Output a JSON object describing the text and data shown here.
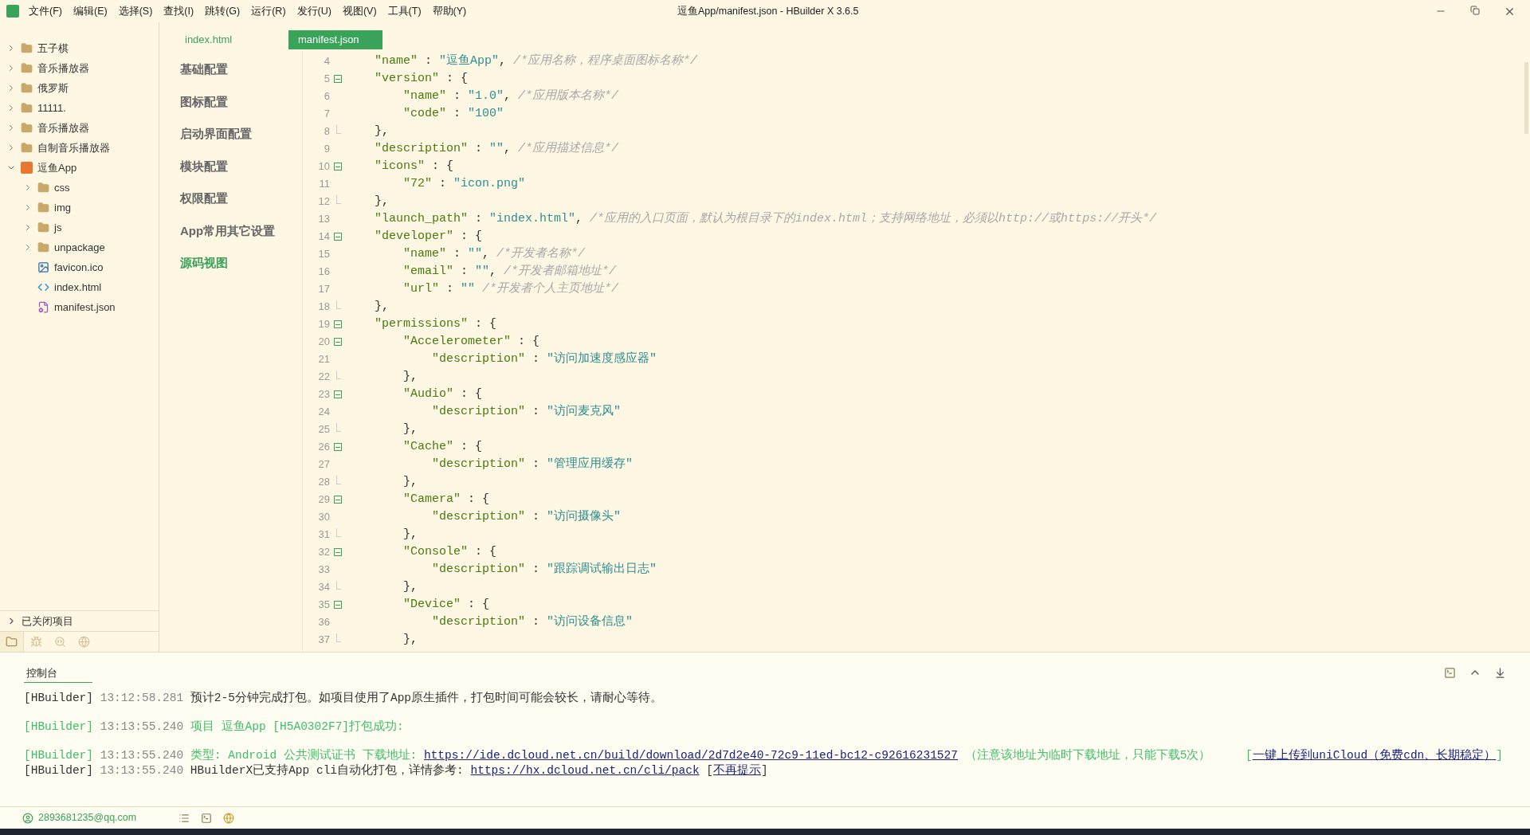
{
  "window": {
    "title": "逗鱼App/manifest.json - HBuilder X 3.6.5"
  },
  "menu": [
    "文件(F)",
    "编辑(E)",
    "选择(S)",
    "查找(I)",
    "跳转(G)",
    "运行(R)",
    "发行(U)",
    "视图(V)",
    "工具(T)",
    "帮助(Y)"
  ],
  "explorer": {
    "items": [
      {
        "name": "五子棋",
        "kind": "folder",
        "expanded": false
      },
      {
        "name": "音乐播放器",
        "kind": "folder",
        "expanded": false
      },
      {
        "name": "俄罗斯",
        "kind": "folder",
        "expanded": false
      },
      {
        "name": "11111.",
        "kind": "folder",
        "expanded": false
      },
      {
        "name": "音乐播放器",
        "kind": "folder",
        "expanded": false
      },
      {
        "name": "自制音乐播放器",
        "kind": "folder",
        "expanded": false
      },
      {
        "name": "逗鱼App",
        "kind": "project",
        "expanded": true,
        "children": [
          {
            "name": "css",
            "kind": "dir",
            "expanded": false
          },
          {
            "name": "img",
            "kind": "dir",
            "expanded": false
          },
          {
            "name": "js",
            "kind": "dir",
            "expanded": false
          },
          {
            "name": "unpackage",
            "kind": "dir",
            "expanded": false
          },
          {
            "name": "favicon.ico",
            "kind": "image"
          },
          {
            "name": "index.html",
            "kind": "html"
          },
          {
            "name": "manifest.json",
            "kind": "json"
          }
        ]
      }
    ],
    "closed_projects": {
      "label": "已关闭项目",
      "expanded": false
    },
    "tabs": [
      {
        "kind": "files",
        "selected": true
      },
      {
        "kind": "debug",
        "selected": false
      },
      {
        "kind": "search",
        "selected": false
      },
      {
        "kind": "cloud",
        "selected": false
      }
    ]
  },
  "editor_tabs": [
    {
      "label": "index.html",
      "selected": false
    },
    {
      "label": "manifest.json",
      "selected": true
    }
  ],
  "config_nav": [
    {
      "label": "基础配置",
      "selected": false
    },
    {
      "label": "图标配置",
      "selected": false
    },
    {
      "label": "启动界面配置",
      "selected": false
    },
    {
      "label": "模块配置",
      "selected": false
    },
    {
      "label": "权限配置",
      "selected": false
    },
    {
      "label": "App常用其它设置",
      "selected": false
    },
    {
      "label": "源码视图",
      "selected": true
    }
  ],
  "code": [
    {
      "no": "4",
      "kind": "plain",
      "parts": [
        {
          "kind": "key",
          "text": "    \"name\""
        },
        {
          "kind": "punct",
          "text": " : "
        },
        {
          "kind": "string",
          "text": "\"逗鱼App\""
        },
        {
          "kind": "punct",
          "text": ", "
        },
        {
          "kind": "comment",
          "text": "/*应用名称，程序桌面图标名称*/"
        }
      ]
    },
    {
      "no": "5",
      "kind": "fold-start",
      "parts": [
        {
          "kind": "key",
          "text": "    \"version\""
        },
        {
          "kind": "punct",
          "text": " : {"
        }
      ]
    },
    {
      "no": "6",
      "kind": "plain",
      "parts": [
        {
          "kind": "key",
          "text": "        \"name\""
        },
        {
          "kind": "punct",
          "text": " : "
        },
        {
          "kind": "string",
          "text": "\"1.0\""
        },
        {
          "kind": "punct",
          "text": ", "
        },
        {
          "kind": "comment",
          "text": "/*应用版本名称*/"
        }
      ]
    },
    {
      "no": "7",
      "kind": "plain",
      "parts": [
        {
          "kind": "key",
          "text": "        \"code\""
        },
        {
          "kind": "punct",
          "text": " : "
        },
        {
          "kind": "string",
          "text": "\"100\""
        }
      ]
    },
    {
      "no": "8",
      "kind": "fold-end",
      "parts": [
        {
          "kind": "punct",
          "text": "    },"
        }
      ]
    },
    {
      "no": "9",
      "kind": "plain",
      "parts": [
        {
          "kind": "key",
          "text": "    \"description\""
        },
        {
          "kind": "punct",
          "text": " : "
        },
        {
          "kind": "string",
          "text": "\"\""
        },
        {
          "kind": "punct",
          "text": ", "
        },
        {
          "kind": "comment",
          "text": "/*应用描述信息*/"
        }
      ]
    },
    {
      "no": "10",
      "kind": "fold-start",
      "parts": [
        {
          "kind": "key",
          "text": "    \"icons\""
        },
        {
          "kind": "punct",
          "text": " : {"
        }
      ]
    },
    {
      "no": "11",
      "kind": "plain",
      "parts": [
        {
          "kind": "key",
          "text": "        \"72\""
        },
        {
          "kind": "punct",
          "text": " : "
        },
        {
          "kind": "string",
          "text": "\"icon.png\""
        }
      ]
    },
    {
      "no": "12",
      "kind": "fold-end",
      "parts": [
        {
          "kind": "punct",
          "text": "    },"
        }
      ]
    },
    {
      "no": "13",
      "kind": "plain",
      "parts": [
        {
          "kind": "key",
          "text": "    \"launch_path\""
        },
        {
          "kind": "punct",
          "text": " : "
        },
        {
          "kind": "string",
          "text": "\"index.html\""
        },
        {
          "kind": "punct",
          "text": ", "
        },
        {
          "kind": "comment",
          "text": "/*应用的入口页面，默认为根目录下的index.html；支持网络地址，必须以http://或https://开头*/"
        }
      ]
    },
    {
      "no": "14",
      "kind": "fold-start",
      "parts": [
        {
          "kind": "key",
          "text": "    \"developer\""
        },
        {
          "kind": "punct",
          "text": " : {"
        }
      ]
    },
    {
      "no": "15",
      "kind": "plain",
      "parts": [
        {
          "kind": "key",
          "text": "        \"name\""
        },
        {
          "kind": "punct",
          "text": " : "
        },
        {
          "kind": "string",
          "text": "\"\""
        },
        {
          "kind": "punct",
          "text": ", "
        },
        {
          "kind": "comment",
          "text": "/*开发者名称*/"
        }
      ]
    },
    {
      "no": "16",
      "kind": "plain",
      "parts": [
        {
          "kind": "key",
          "text": "        \"email\""
        },
        {
          "kind": "punct",
          "text": " : "
        },
        {
          "kind": "string",
          "text": "\"\""
        },
        {
          "kind": "punct",
          "text": ", "
        },
        {
          "kind": "comment",
          "text": "/*开发者邮箱地址*/"
        }
      ]
    },
    {
      "no": "17",
      "kind": "plain",
      "parts": [
        {
          "kind": "key",
          "text": "        \"url\""
        },
        {
          "kind": "punct",
          "text": " : "
        },
        {
          "kind": "string",
          "text": "\"\""
        },
        {
          "kind": "comment",
          "text": " /*开发者个人主页地址*/"
        }
      ]
    },
    {
      "no": "18",
      "kind": "fold-end",
      "parts": [
        {
          "kind": "punct",
          "text": "    },"
        }
      ]
    },
    {
      "no": "19",
      "kind": "fold-start",
      "parts": [
        {
          "kind": "key",
          "text": "    \"permissions\""
        },
        {
          "kind": "punct",
          "text": " : {"
        }
      ]
    },
    {
      "no": "20",
      "kind": "fold-start",
      "parts": [
        {
          "kind": "key",
          "text": "        \"Accelerometer\""
        },
        {
          "kind": "punct",
          "text": " : {"
        }
      ]
    },
    {
      "no": "21",
      "kind": "plain",
      "parts": [
        {
          "kind": "key",
          "text": "            \"description\""
        },
        {
          "kind": "punct",
          "text": " : "
        },
        {
          "kind": "string",
          "text": "\"访问加速度感应器\""
        }
      ]
    },
    {
      "no": "22",
      "kind": "fold-end",
      "parts": [
        {
          "kind": "punct",
          "text": "        },"
        }
      ]
    },
    {
      "no": "23",
      "kind": "fold-start",
      "parts": [
        {
          "kind": "key",
          "text": "        \"Audio\""
        },
        {
          "kind": "punct",
          "text": " : {"
        }
      ]
    },
    {
      "no": "24",
      "kind": "plain",
      "parts": [
        {
          "kind": "key",
          "text": "            \"description\""
        },
        {
          "kind": "punct",
          "text": " : "
        },
        {
          "kind": "string",
          "text": "\"访问麦克风\""
        }
      ]
    },
    {
      "no": "25",
      "kind": "fold-end",
      "parts": [
        {
          "kind": "punct",
          "text": "        },"
        }
      ]
    },
    {
      "no": "26",
      "kind": "fold-start",
      "parts": [
        {
          "kind": "key",
          "text": "        \"Cache\""
        },
        {
          "kind": "punct",
          "text": " : {"
        }
      ]
    },
    {
      "no": "27",
      "kind": "plain",
      "parts": [
        {
          "kind": "key",
          "text": "            \"description\""
        },
        {
          "kind": "punct",
          "text": " : "
        },
        {
          "kind": "string",
          "text": "\"管理应用缓存\""
        }
      ]
    },
    {
      "no": "28",
      "kind": "fold-end",
      "parts": [
        {
          "kind": "punct",
          "text": "        },"
        }
      ]
    },
    {
      "no": "29",
      "kind": "fold-start",
      "parts": [
        {
          "kind": "key",
          "text": "        \"Camera\""
        },
        {
          "kind": "punct",
          "text": " : {"
        }
      ]
    },
    {
      "no": "30",
      "kind": "plain",
      "parts": [
        {
          "kind": "key",
          "text": "            \"description\""
        },
        {
          "kind": "punct",
          "text": " : "
        },
        {
          "kind": "string",
          "text": "\"访问摄像头\""
        }
      ]
    },
    {
      "no": "31",
      "kind": "fold-end",
      "parts": [
        {
          "kind": "punct",
          "text": "        },"
        }
      ]
    },
    {
      "no": "32",
      "kind": "fold-start",
      "parts": [
        {
          "kind": "key",
          "text": "        \"Console\""
        },
        {
          "kind": "punct",
          "text": " : {"
        }
      ]
    },
    {
      "no": "33",
      "kind": "plain",
      "parts": [
        {
          "kind": "key",
          "text": "            \"description\""
        },
        {
          "kind": "punct",
          "text": " : "
        },
        {
          "kind": "string",
          "text": "\"跟踪调试输出日志\""
        }
      ]
    },
    {
      "no": "34",
      "kind": "fold-end",
      "parts": [
        {
          "kind": "punct",
          "text": "        },"
        }
      ]
    },
    {
      "no": "35",
      "kind": "fold-start",
      "parts": [
        {
          "kind": "key",
          "text": "        \"Device\""
        },
        {
          "kind": "punct",
          "text": " : {"
        }
      ]
    },
    {
      "no": "36",
      "kind": "plain",
      "parts": [
        {
          "kind": "key",
          "text": "            \"description\""
        },
        {
          "kind": "punct",
          "text": " : "
        },
        {
          "kind": "string",
          "text": "\"访问设备信息\""
        }
      ]
    },
    {
      "no": "37",
      "kind": "fold-end",
      "parts": [
        {
          "kind": "punct",
          "text": "        },"
        }
      ]
    }
  ],
  "console": {
    "title": "控制台",
    "messages": [
      {
        "kind": "info",
        "parts": [
          {
            "kind": "source",
            "text": "[HBuilder]"
          },
          {
            "kind": "time",
            "text": " 13:12:58.281 "
          },
          {
            "kind": "text",
            "text": "预计2-5分钟完成打包。如项目使用了App原生插件，打包时间可能会较长，请耐心等待。"
          }
        ]
      },
      {
        "kind": "success",
        "parts": [
          {
            "kind": "source",
            "text": "[HBuilder]"
          },
          {
            "kind": "time",
            "text": " 13:13:55.240 "
          },
          {
            "kind": "text",
            "text": "项目 逗鱼App [H5A0302F7]打包成功:"
          }
        ]
      },
      {
        "kind": "success",
        "parts": [
          {
            "kind": "source",
            "text": "[HBuilder]"
          },
          {
            "kind": "time",
            "text": " 13:13:55.240 "
          },
          {
            "kind": "text",
            "text": "类型: Android 公共测试证书 下载地址: "
          },
          {
            "kind": "link",
            "text": "https://ide.dcloud.net.cn/build/download/2d7d2e40-72c9-11ed-bc12-c92616231527"
          },
          {
            "kind": "text",
            "text": " （注意该地址为临时下载地址，只能下载5次）     ["
          },
          {
            "kind": "link",
            "text": "一键上传到uniCloud（免费cdn、长期稳定）"
          },
          {
            "kind": "text",
            "text": "]"
          }
        ]
      },
      {
        "kind": "info",
        "parts": [
          {
            "kind": "source",
            "text": "[HBuilder]"
          },
          {
            "kind": "time",
            "text": " 13:13:55.240 "
          },
          {
            "kind": "text",
            "text": "HBuilderX已支持App cli自动化打包，详情参考: "
          },
          {
            "kind": "link",
            "text": "https://hx.dcloud.net.cn/cli/pack"
          },
          {
            "kind": "text",
            "text": " ["
          },
          {
            "kind": "link",
            "text": "不再提示"
          },
          {
            "kind": "text",
            "text": "]"
          }
        ]
      }
    ]
  },
  "status_bar": {
    "account": "2893681235@qq.com"
  }
}
